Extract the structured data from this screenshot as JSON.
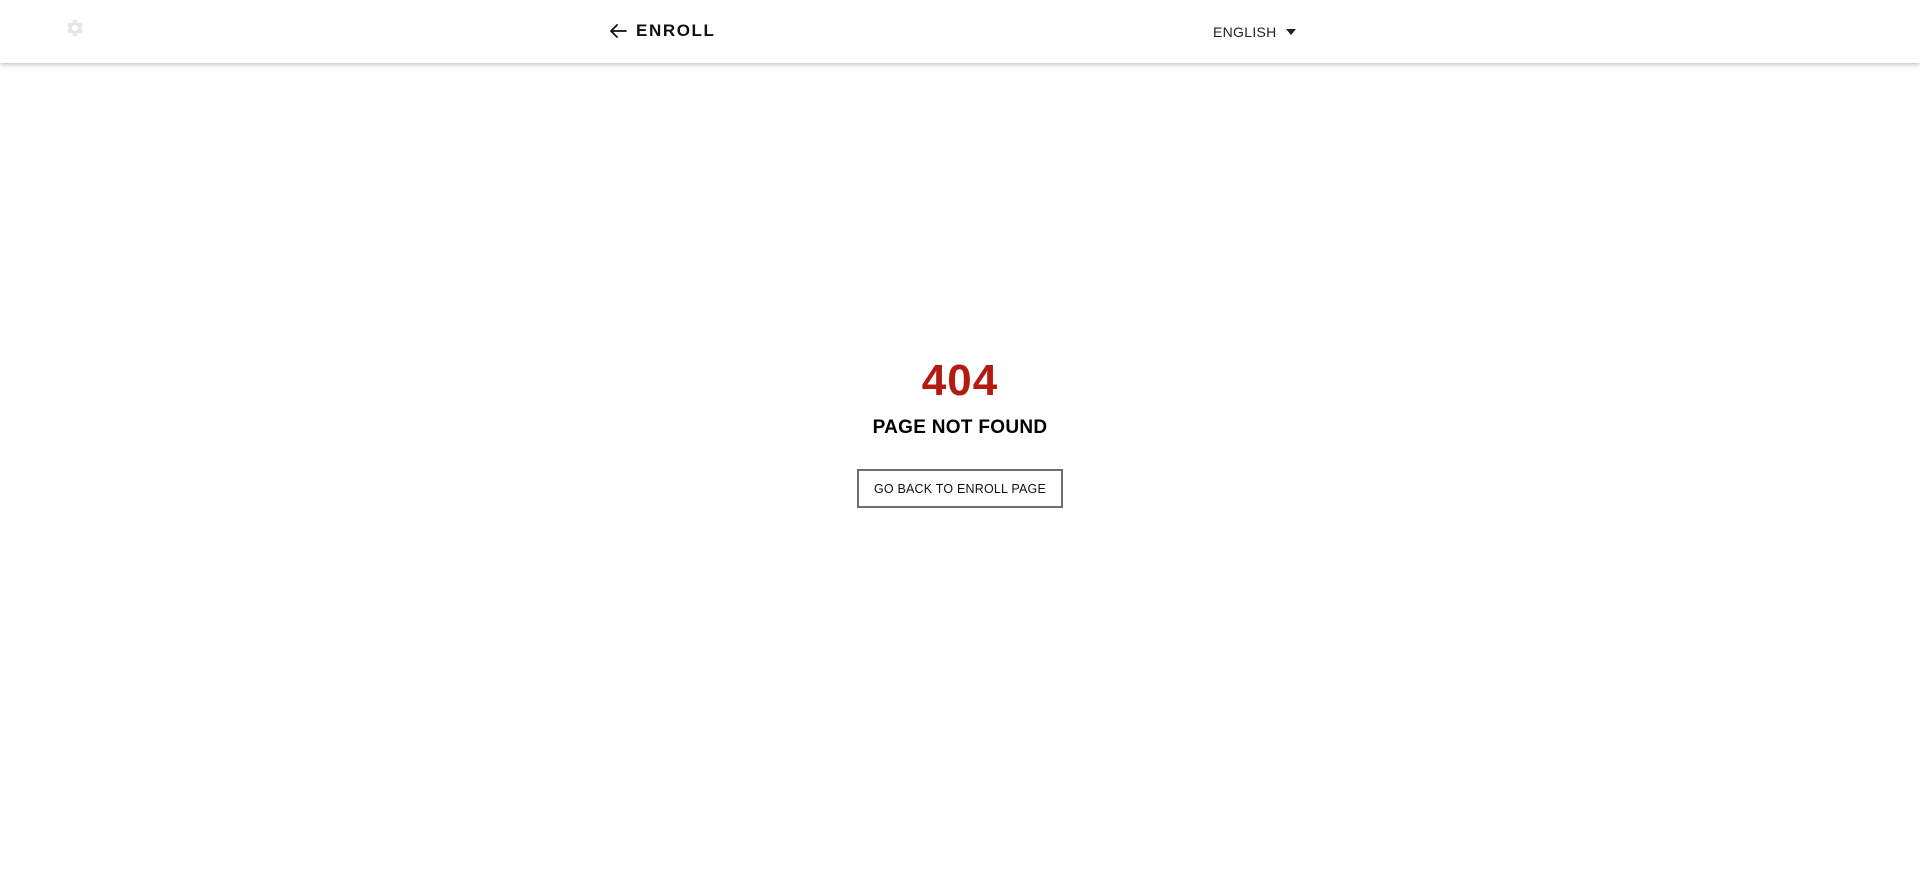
{
  "header": {
    "settings_icon": "gear-icon",
    "back_icon": "arrow-left-icon",
    "back_label": "ENROLL",
    "language": {
      "selected": "ENGLISH",
      "icon": "caret-down-icon"
    }
  },
  "error": {
    "code": "404",
    "message": "PAGE NOT FOUND",
    "button_label": "GO BACK TO ENROLL PAGE"
  },
  "colors": {
    "accent": "#b31b12",
    "text": "#111111",
    "border": "#6e6e6e",
    "background": "#ffffff",
    "settings_icon": "#e6e6e6"
  }
}
